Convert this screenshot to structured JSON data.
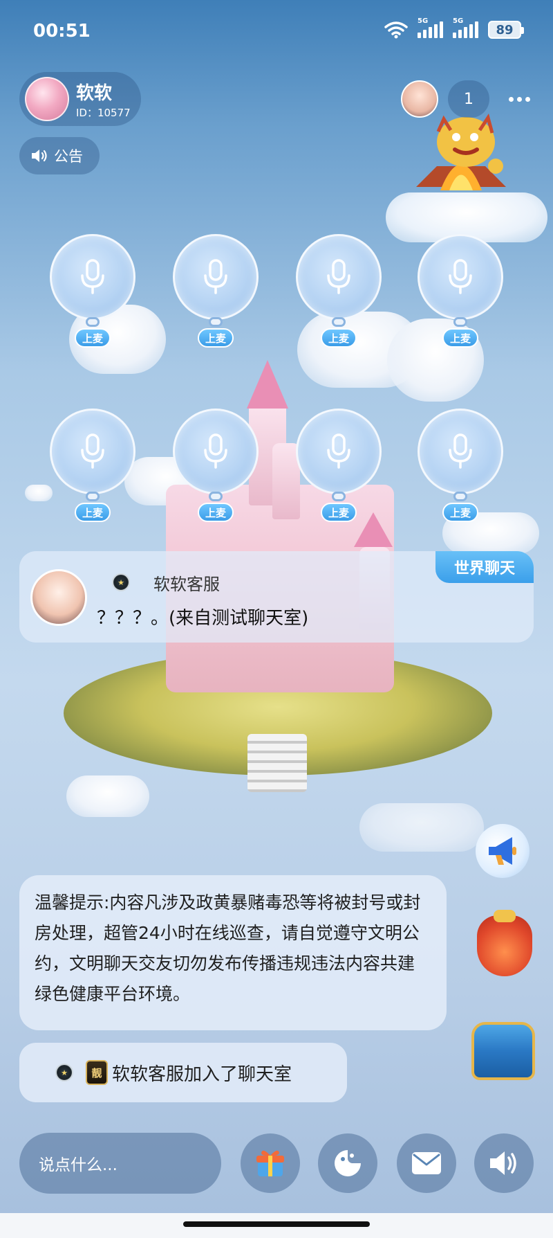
{
  "status_bar": {
    "time": "00:51",
    "sig1_label": "5G",
    "sig2_label": "5G",
    "battery": "89"
  },
  "room_owner": {
    "name": "软软",
    "id": "ID：10577"
  },
  "notice": {
    "label": "公告"
  },
  "online_count": "1",
  "seats": [
    {
      "label": "上麦"
    },
    {
      "label": "上麦"
    },
    {
      "label": "上麦"
    },
    {
      "label": "上麦"
    },
    {
      "label": "上麦"
    },
    {
      "label": "上麦"
    },
    {
      "label": "上麦"
    },
    {
      "label": "上麦"
    }
  ],
  "world_chat": {
    "tag": "世界聊天",
    "sender": "软软客服",
    "message": "？？？。(来自测试聊天室)"
  },
  "messages": {
    "tip": "温馨提示:内容凡涉及政黄暴赌毒恐等将被封号或封房处理，超管24小时在线巡查，请自觉遵守文明公约，文明聊天交友切勿发布传播违规违法内容共建绿色健康平台环境。",
    "join_badge": "靓",
    "join": "软软客服加入了聊天室"
  },
  "input": {
    "placeholder": "说点什么..."
  },
  "icons": {
    "speaker": "speaker-icon",
    "mic": "microphone-icon",
    "gift": "gift-icon",
    "emoji": "emoji-icon",
    "mail": "mail-icon",
    "sound": "volume-icon"
  },
  "colors": {
    "accent": "#3b9fea",
    "seat_bubble": "#b5d3f3"
  }
}
